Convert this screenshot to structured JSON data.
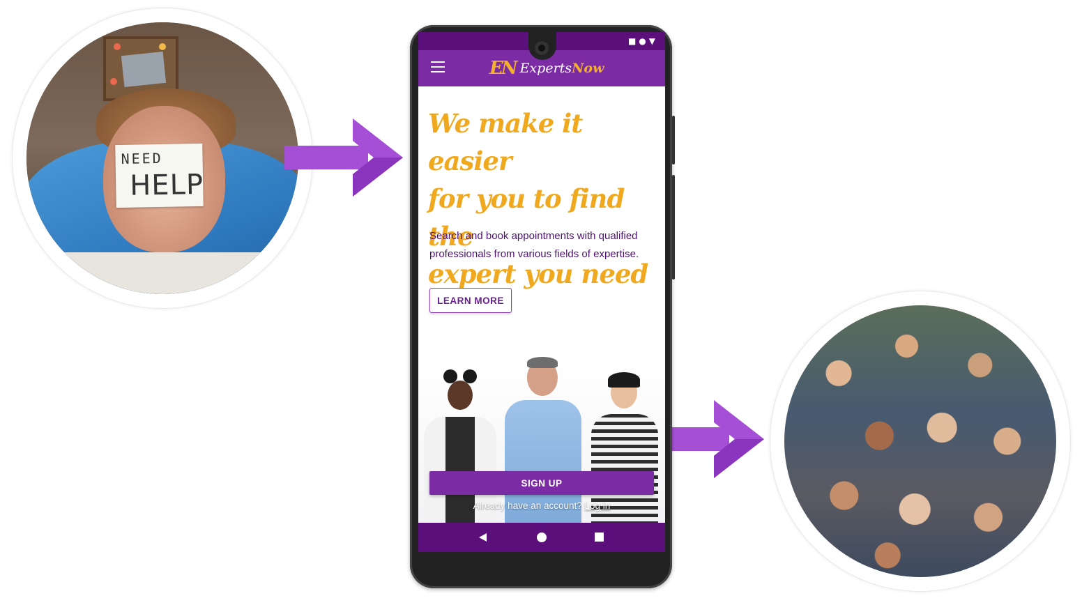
{
  "left_photo": {
    "sticky_note_line1": "NEED",
    "sticky_note_line2": "HELP"
  },
  "phone": {
    "status_icons": "■●▼",
    "app": {
      "logo_mark": "EN",
      "logo_word_start": "Experts",
      "logo_word_end": "Now"
    },
    "hero": {
      "headline_line1": "We make it easier",
      "headline_line2": "for you to find the",
      "headline_line3": "expert you need",
      "description": "Search and book appointments with qualified professionals from various fields of expertise.",
      "learn_more_label": "LEARN MORE"
    },
    "signup_label": "SIGN UP",
    "account_prompt": "Already have an account?",
    "login_link": "Log in"
  },
  "colors": {
    "brand_purple": "#7b2ca5",
    "dark_purple": "#5b0f7a",
    "accent_gold": "#f0a91e",
    "arrow_purple": "#a54fd6"
  }
}
